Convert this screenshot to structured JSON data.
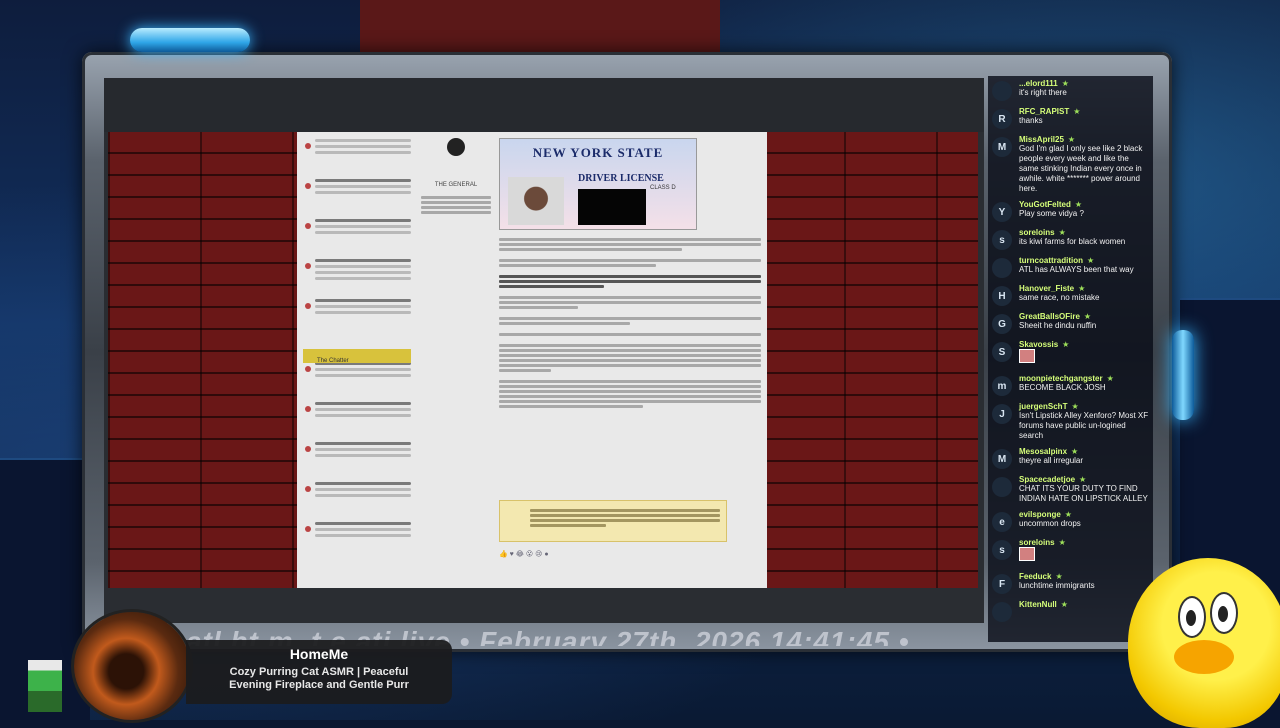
{
  "stream": {
    "ticker_text": "atl.ht.m..t.e.ati live • February 27th, 2026 14:41:45 •"
  },
  "now_playing": {
    "title": "HomeMe",
    "song_line1": "Cozy Purring Cat ASMR | Peaceful",
    "song_line2": "Evening Fireplace and Gentle Purr"
  },
  "captured_page": {
    "user_name": "THE GENERAL",
    "sidebar_section": "The Chatter",
    "license_header": "NEW YORK STATE",
    "license_sub": "DRIVER LICENSE",
    "license_class": "CLASS D"
  },
  "chat": {
    "messages": [
      {
        "initial": "",
        "user": "...elord111",
        "text": "it's right there"
      },
      {
        "initial": "R",
        "user": "RFC_RAPIST",
        "text": "thanks"
      },
      {
        "initial": "M",
        "user": "MissApril25",
        "text": "God I'm glad I only see like 2 black people every week and like the same stinking Indian every once in awhile. white ******* power around here."
      },
      {
        "initial": "Y",
        "user": "YouGotFelted",
        "text": "Play some vidya ?"
      },
      {
        "initial": "s",
        "user": "soreloins",
        "text": "its kiwi farms for black women"
      },
      {
        "initial": "",
        "user": "turncoattradition",
        "text": "ATL has ALWAYS been that way"
      },
      {
        "initial": "H",
        "user": "Hanover_Fiste",
        "text": "same race, no mistake"
      },
      {
        "initial": "G",
        "user": "GreatBallsOFire",
        "text": "Sheeit he dindu nuffin"
      },
      {
        "initial": "S",
        "user": "Skavossis",
        "text": "",
        "emote": true
      },
      {
        "initial": "m",
        "user": "moonpietechgangster",
        "text": "BECOME BLACK JOSH"
      },
      {
        "initial": "J",
        "user": "juergenSchT",
        "text": "Isn't Lipstick Alley Xenforo? Most XF forums have public un-logined search"
      },
      {
        "initial": "M",
        "user": "Mesosalpinx",
        "text": "theyre all irregular"
      },
      {
        "initial": "",
        "user": "Spacecadetjoe",
        "text": "CHAT ITS YOUR DUTY TO FIND INDIAN HATE ON LIPSTICK ALLEY"
      },
      {
        "initial": "e",
        "user": "evilsponge",
        "text": "uncommon drops"
      },
      {
        "initial": "s",
        "user": "soreloins",
        "text": "",
        "emote": true
      },
      {
        "initial": "F",
        "user": "Feeduck",
        "text": "lunchtime immigrants"
      },
      {
        "initial": "",
        "user": "KittenNull",
        "text": ""
      }
    ]
  }
}
